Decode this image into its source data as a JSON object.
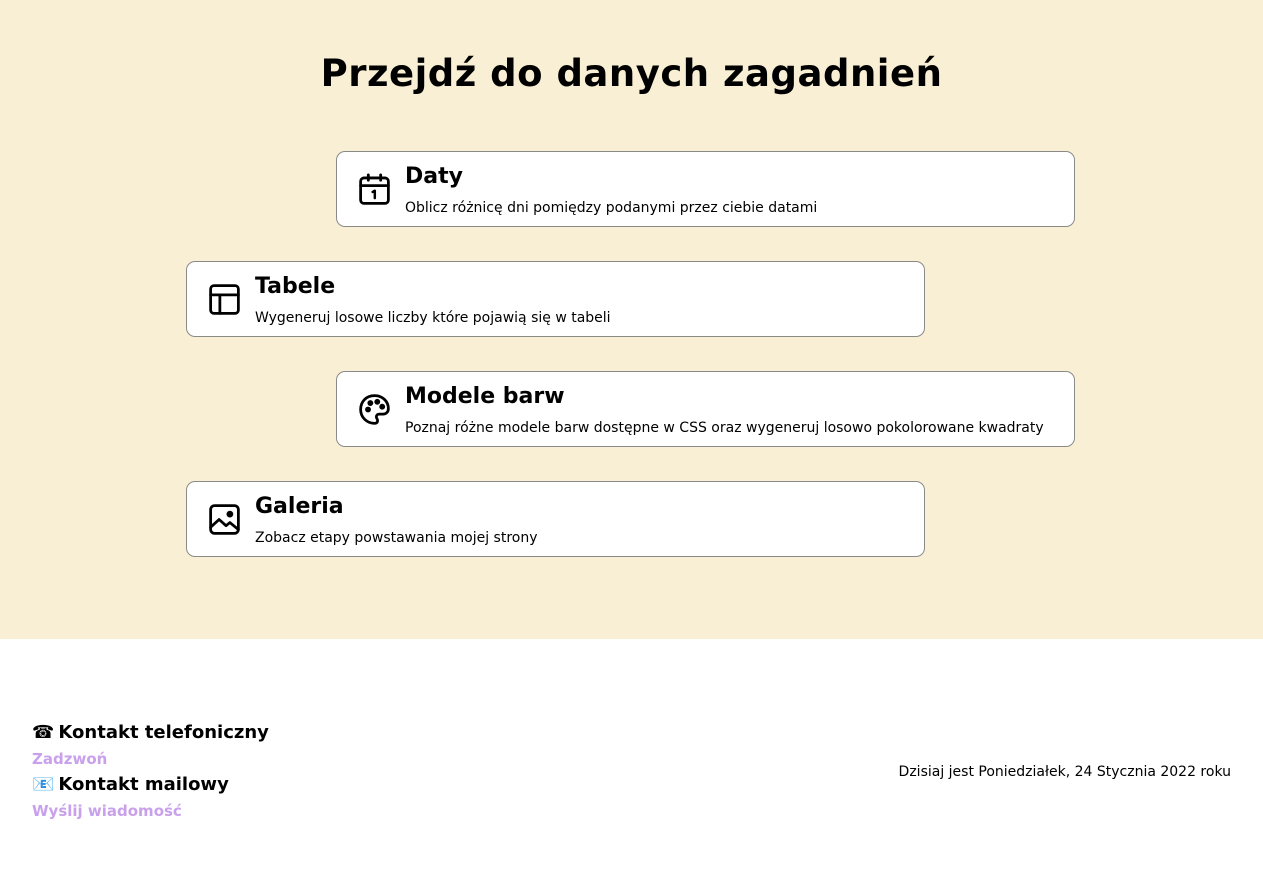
{
  "page": {
    "title": "Przejdź do danych zagadnień",
    "background_color": "#f8efd5",
    "link_color": "#c9a0ec"
  },
  "cards": [
    {
      "icon": "calendar-icon",
      "title": "Daty",
      "description": "Oblicz różnicę dni pomiędzy podanymi przez ciebie datami"
    },
    {
      "icon": "table-icon",
      "title": "Tabele",
      "description": "Wygeneruj losowe liczby które pojawią się w tabeli"
    },
    {
      "icon": "palette-icon",
      "title": "Modele barw",
      "description": "Poznaj różne modele barw dostępne w CSS oraz wygeneruj losowo pokolorowane kwadraty"
    },
    {
      "icon": "image-icon",
      "title": "Galeria",
      "description": "Zobacz etapy powstawania mojej strony"
    }
  ],
  "footer": {
    "phone": {
      "icon": "telephone-icon",
      "glyph": "☎",
      "heading": "Kontakt telefoniczny",
      "link": "Zadzwoń"
    },
    "mail": {
      "icon": "envelope-icon",
      "glyph": "📧",
      "heading": "Kontakt mailowy",
      "link": "Wyślij wiadomość"
    },
    "date_text": "Dzisiaj jest Poniedziałek, 24 Stycznia 2022 roku"
  }
}
